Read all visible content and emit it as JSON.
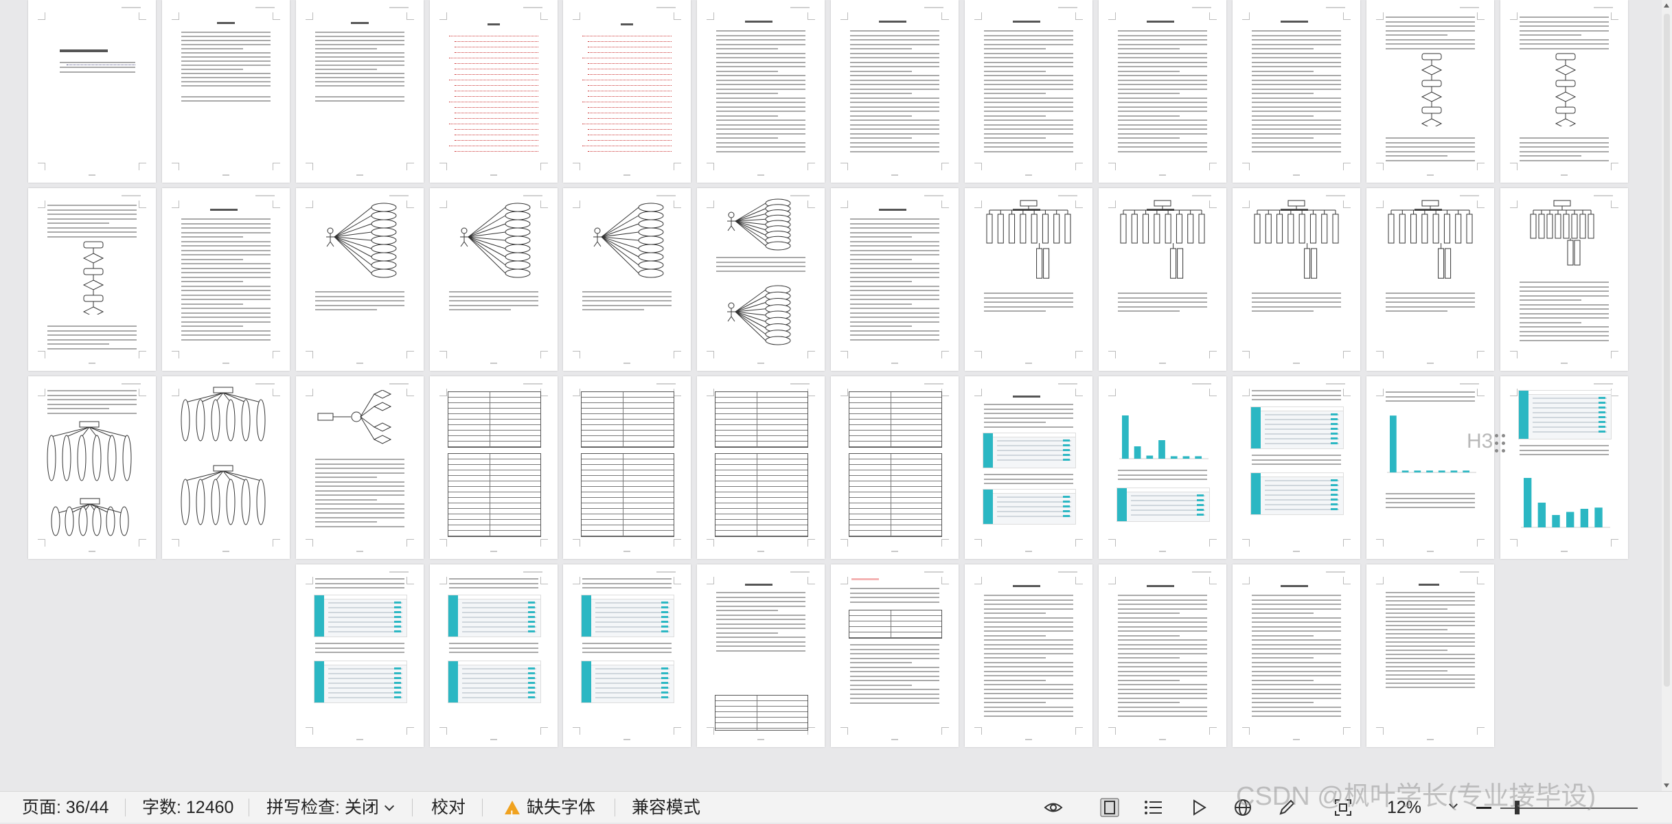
{
  "status_bar": {
    "page": "页面: 36/44",
    "word_count": "字数: 12460",
    "spellcheck": "拼写检查: 关闭",
    "proofread": "校对",
    "missing_font": "缺失字体",
    "compat_mode": "兼容模式",
    "zoom": "12%"
  },
  "watermark": "CSDN @枫叶学长(专业接毕设)",
  "floating_heading_label": "H3",
  "document": {
    "cover_title": "毕 业 设 计 (论 文)",
    "page_count": 44,
    "current_page": 36
  },
  "icons": [
    "eye-icon",
    "page-view-icon",
    "outline-icon",
    "play-icon",
    "web-layout-icon",
    "pen-icon",
    "fit-page-icon",
    "zoom-out-icon"
  ],
  "colors": {
    "accent": "#2bb7c3",
    "warning": "#f0a21f"
  }
}
